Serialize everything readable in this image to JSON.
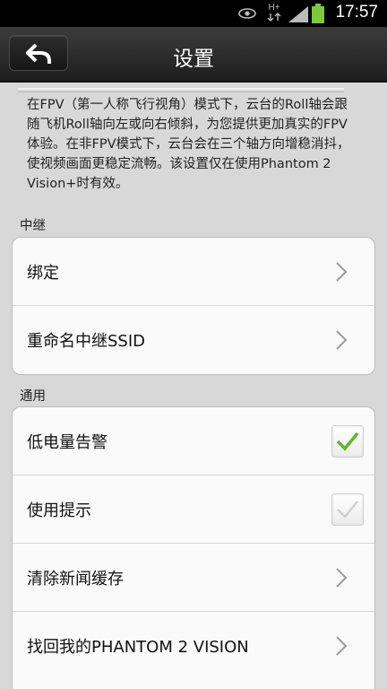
{
  "status_bar": {
    "time": "17:57",
    "icons": [
      "eye-icon",
      "data-transfer-icon",
      "signal-icon",
      "battery-icon"
    ],
    "network_label": "H+"
  },
  "header": {
    "title": "设置",
    "back_icon": "back-arrow-icon"
  },
  "description": "在FPV（第一人称飞行视角）模式下，云台的Roll轴会跟随飞机Roll轴向左或向右倾斜，为您提供更加真实的FPV体验。在非FPV模式下，云台会在三个轴方向增稳消抖，使视频画面更稳定流畅。该设置仅在使用Phantom 2 Vision+时有效。",
  "relay_section": {
    "header": "中继",
    "items": [
      {
        "label": "绑定"
      },
      {
        "label": "重命名中继SSID"
      }
    ]
  },
  "general_section": {
    "header": "通用",
    "items": [
      {
        "label": "低电量告警",
        "checked": true,
        "enabled": true
      },
      {
        "label": "使用提示",
        "checked": true,
        "enabled": false
      },
      {
        "label": "清除新闻缓存"
      },
      {
        "label": "找回我的PHANTOM 2 VISION"
      }
    ]
  },
  "colors": {
    "check_enabled": "#5cb82e",
    "check_disabled": "#cfcfcf",
    "title_bar": "#2a2a2a"
  }
}
